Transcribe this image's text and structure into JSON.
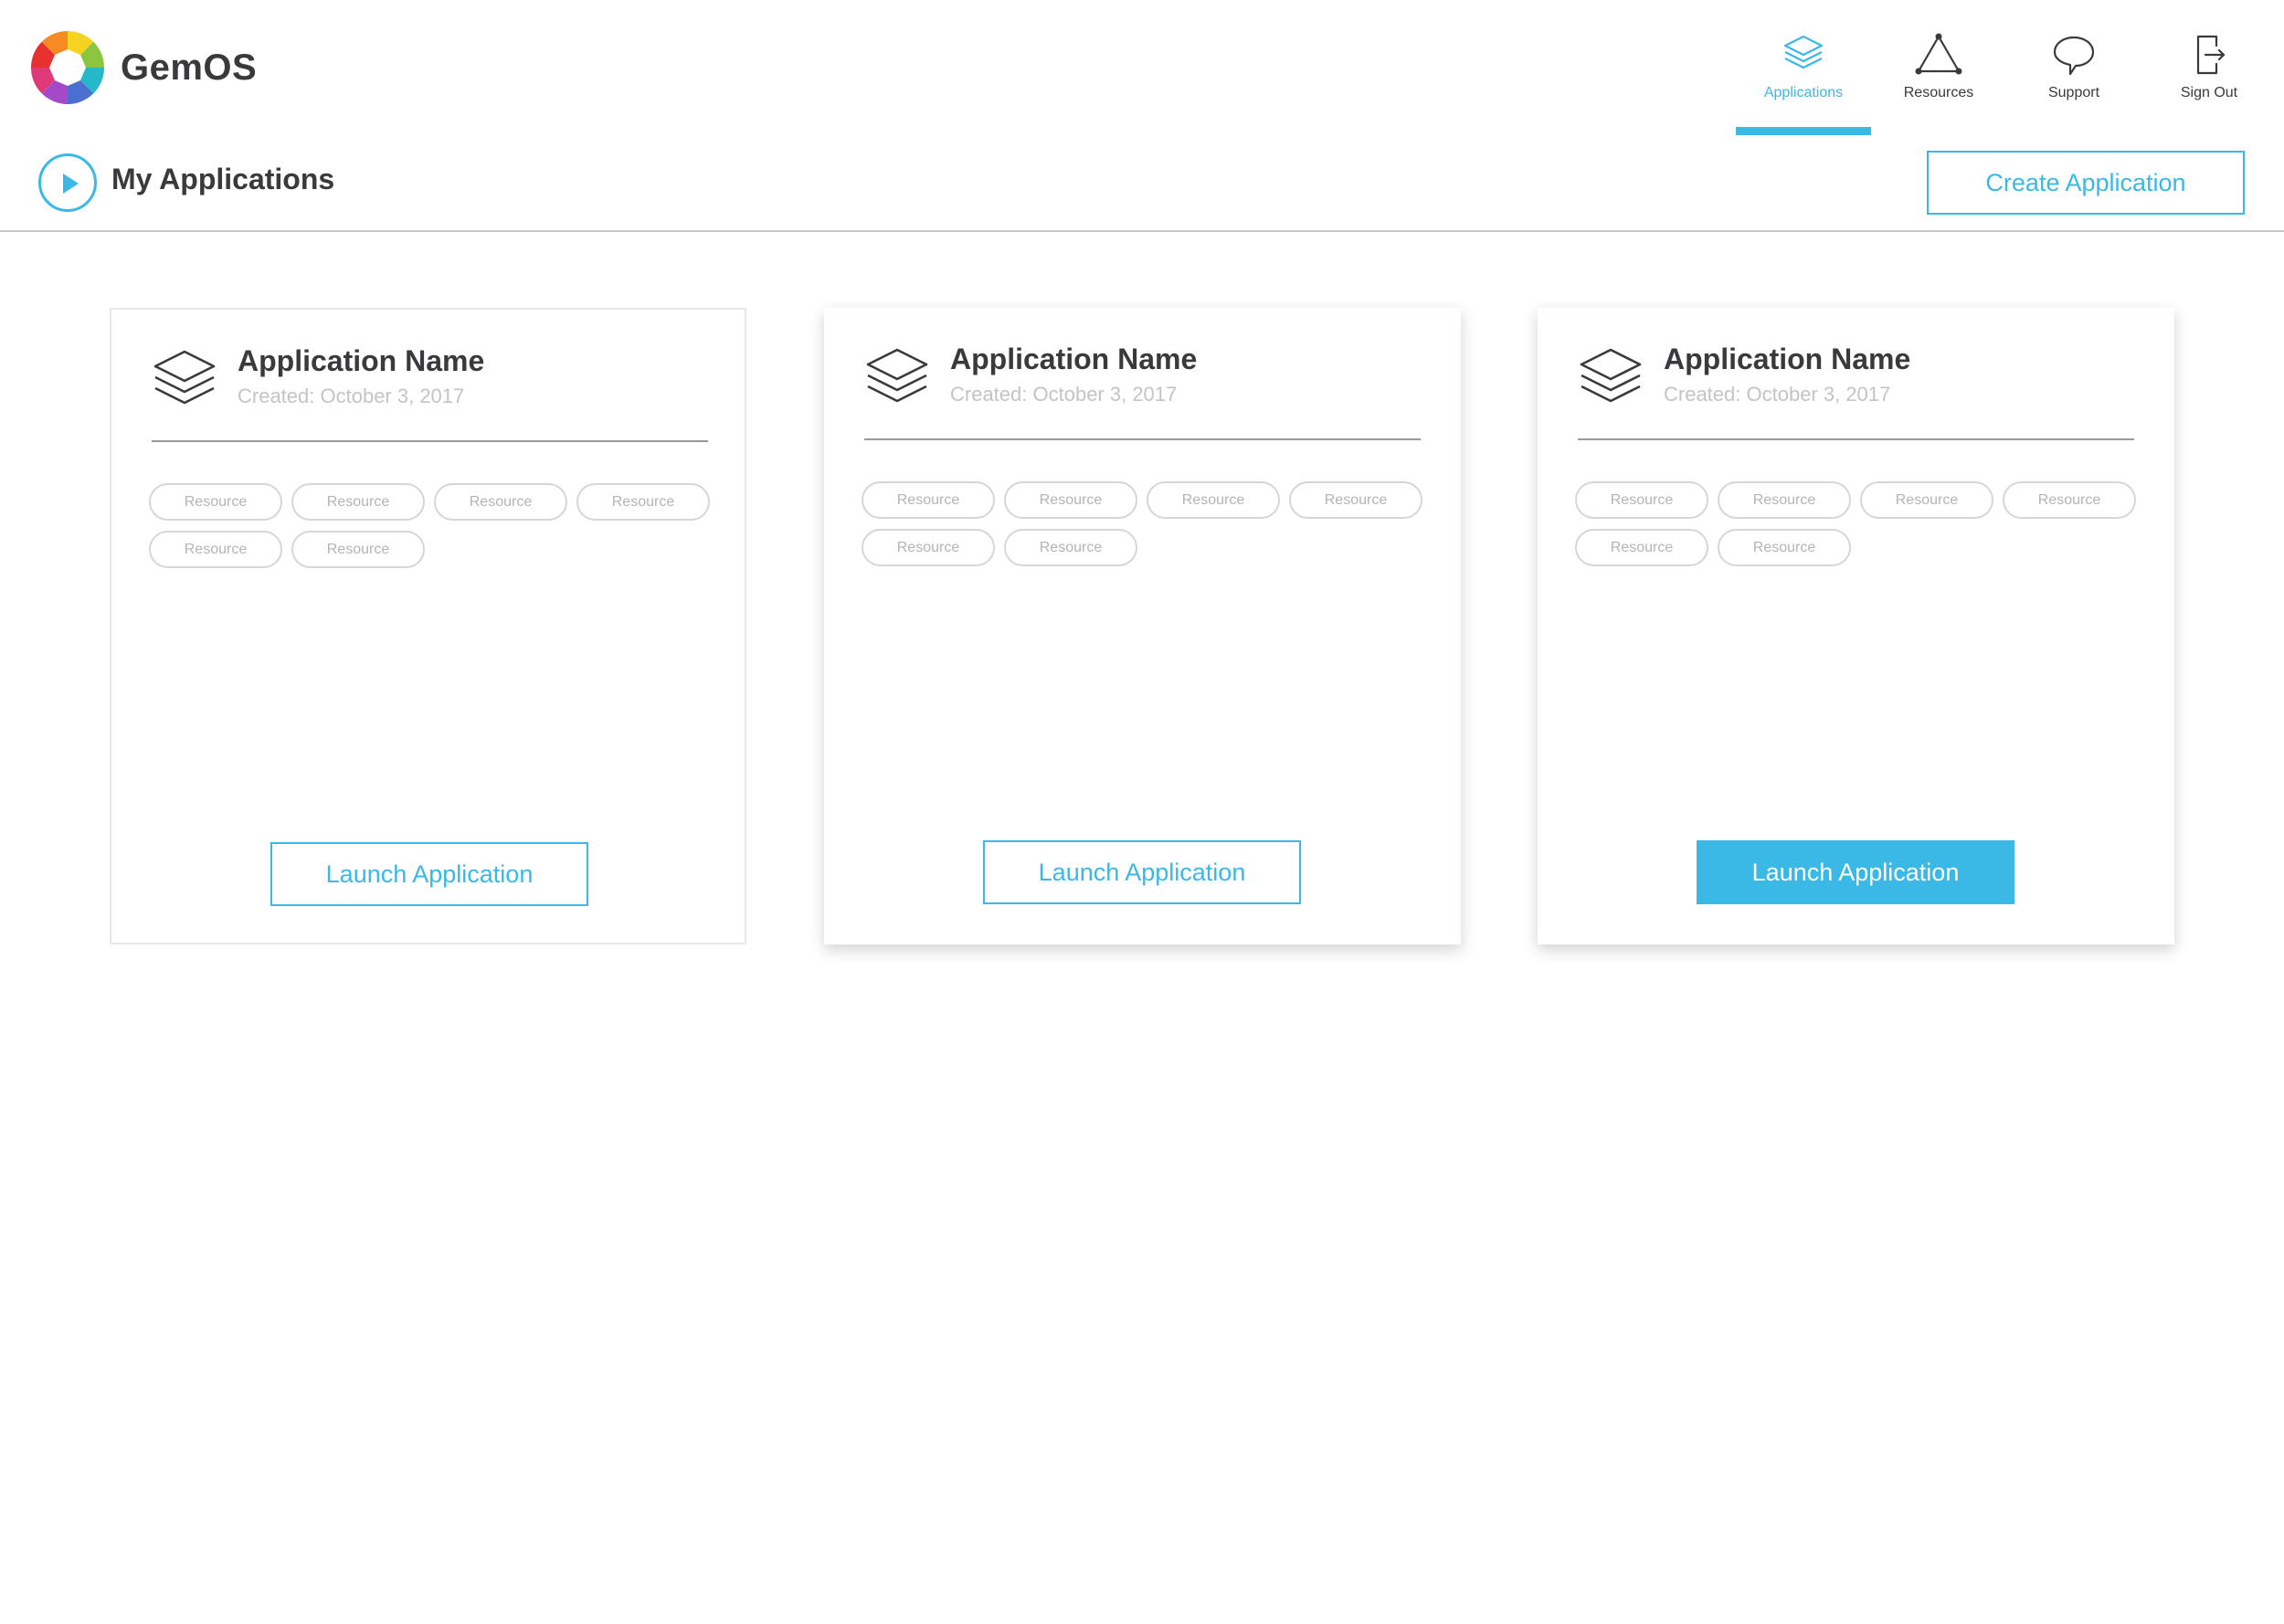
{
  "app": {
    "name": "GemOS"
  },
  "nav": {
    "items": [
      {
        "label": "Applications",
        "icon": "layers-icon",
        "active": true
      },
      {
        "label": "Resources",
        "icon": "triangle-network-icon",
        "active": false
      },
      {
        "label": "Support",
        "icon": "speech-bubble-icon",
        "active": false
      },
      {
        "label": "Sign Out",
        "icon": "sign-out-icon",
        "active": false
      }
    ]
  },
  "page": {
    "title": "My Applications",
    "create_label": "Create Application"
  },
  "cards": [
    {
      "title": "Application Name",
      "created": "Created: October 3, 2017",
      "tags": [
        "Resource",
        "Resource",
        "Resource",
        "Resource",
        "Resource",
        "Resource"
      ],
      "launch_label": "Launch Application",
      "style": "flat",
      "button_filled": false
    },
    {
      "title": "Application Name",
      "created": "Created: October 3, 2017",
      "tags": [
        "Resource",
        "Resource",
        "Resource",
        "Resource",
        "Resource",
        "Resource"
      ],
      "launch_label": "Launch Application",
      "style": "raised",
      "button_filled": false
    },
    {
      "title": "Application Name",
      "created": "Created: October 3, 2017",
      "tags": [
        "Resource",
        "Resource",
        "Resource",
        "Resource",
        "Resource",
        "Resource"
      ],
      "launch_label": "Launch Application",
      "style": "raised",
      "button_filled": true
    }
  ],
  "colors": {
    "accent": "#3ab8e6",
    "text": "#3a3a3c",
    "muted": "#c4c4c4"
  }
}
